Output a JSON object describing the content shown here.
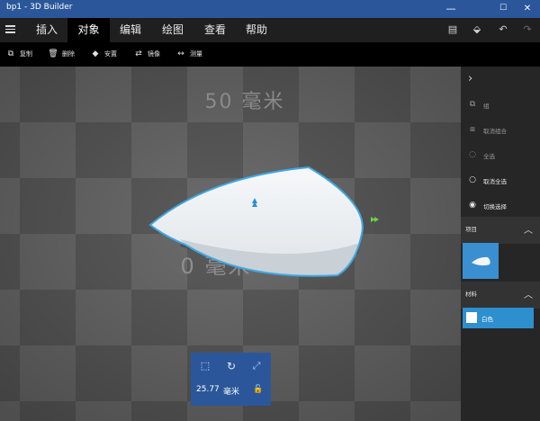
{
  "window": {
    "title": "bp1 - 3D Builder",
    "controls": [
      "—",
      "☐",
      "✕"
    ]
  },
  "menu": {
    "tabs": [
      {
        "label": "插入",
        "active": false
      },
      {
        "label": "对象",
        "active": true
      },
      {
        "label": "编辑",
        "active": false
      },
      {
        "label": "绘图",
        "active": false
      },
      {
        "label": "查看",
        "active": false
      },
      {
        "label": "帮助",
        "active": false
      }
    ]
  },
  "toolbar": {
    "items": [
      {
        "label": "复制",
        "icon": "copy-icon"
      },
      {
        "label": "删除",
        "icon": "trash-icon"
      },
      {
        "label": "安置",
        "icon": "settle-icon"
      },
      {
        "label": "镜像",
        "icon": "mirror-icon"
      },
      {
        "label": "测量",
        "icon": "measure-icon"
      }
    ]
  },
  "viewport": {
    "grid_label_top": "50 毫米",
    "grid_label_bottom": "0 毫米",
    "model_fill": "#ecf0f3",
    "selection_color": "#3fa8e4",
    "floor_light": "#6c6c6c",
    "floor_dark": "#595959"
  },
  "sidebar": {
    "items": [
      {
        "label": "组",
        "icon": "group-icon",
        "enabled": false
      },
      {
        "label": "取消组合",
        "icon": "ungroup-icon",
        "enabled": false
      },
      {
        "label": "全选",
        "icon": "select-all-icon",
        "enabled": false
      },
      {
        "label": "取消全选",
        "icon": "deselect-all-icon",
        "enabled": true
      },
      {
        "label": "切换选择",
        "icon": "toggle-selection-icon",
        "enabled": true
      }
    ],
    "project_heading": "项目",
    "material_heading": "材料",
    "material_value": "白色"
  },
  "panel": {
    "size_value": "25.77",
    "unit": "毫米"
  }
}
